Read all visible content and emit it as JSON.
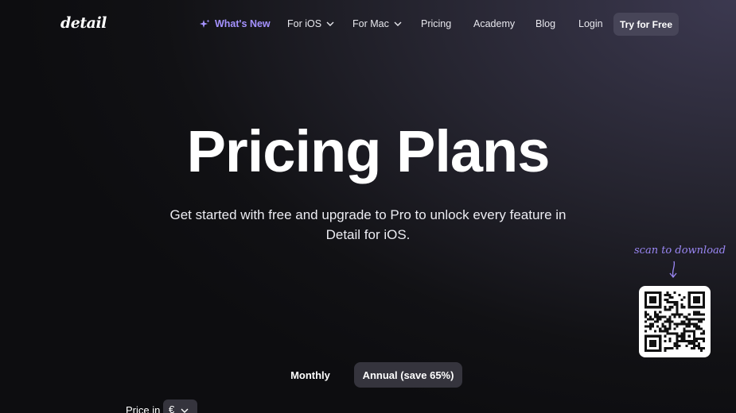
{
  "nav": {
    "logo": "detail",
    "whats_new": "What's New",
    "for_ios": "For iOS",
    "for_mac": "For Mac",
    "pricing": "Pricing",
    "academy": "Academy",
    "blog": "Blog",
    "login": "Login",
    "try_free": "Try for Free"
  },
  "hero": {
    "title": "Pricing Plans",
    "subtitle": "Get started with free and upgrade to Pro to unlock every feature in Detail for iOS."
  },
  "qr": {
    "label": "scan to download"
  },
  "billing": {
    "monthly": "Monthly",
    "annual": "Annual (save 65%)",
    "selected": "Annual (save 65%)"
  },
  "currency": {
    "label": "Price in",
    "value": "€"
  },
  "icons": {
    "whats_new": "sparkle-icon",
    "dropdown": "chevron-down-icon",
    "arrow": "arrow-down-icon"
  },
  "colors": {
    "accent": "#a592ff",
    "button_bg": "#474558",
    "toggle_active_bg": "#35343d"
  }
}
